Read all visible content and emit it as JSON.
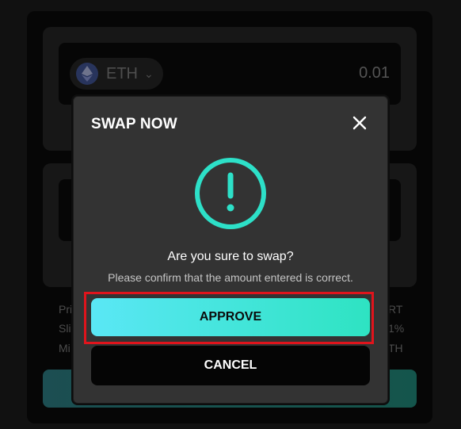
{
  "swap_form": {
    "from_token": {
      "symbol": "ETH",
      "amount": "0.01",
      "icon": "ethereum-icon"
    },
    "info_fragments": {
      "left": [
        "Pri",
        "Sli",
        "Mi"
      ],
      "right": [
        "RT",
        "1%",
        "TH"
      ]
    }
  },
  "modal": {
    "title": "SWAP NOW",
    "close_icon": "close-icon",
    "alert_icon": "exclamation-circle-icon",
    "question": "Are you sure to swap?",
    "hint": "Please confirm that the amount entered is correct.",
    "approve_label": "APPROVE",
    "cancel_label": "CANCEL"
  },
  "colors": {
    "accent_start": "#5ae7f5",
    "accent_end": "#2ee3c2",
    "alert": "#2de0c8",
    "highlight_border": "#e0141c",
    "modal_bg": "#333333"
  }
}
